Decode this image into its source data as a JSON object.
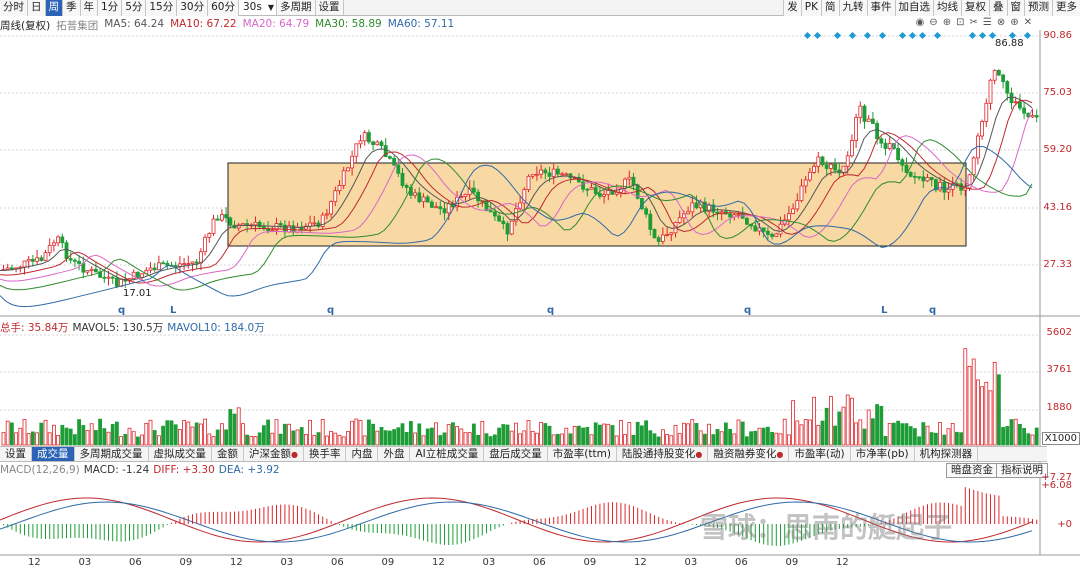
{
  "toolbar": {
    "periods": [
      "分时",
      "日",
      "周",
      "季",
      "年",
      "1分",
      "5分",
      "15分",
      "30分",
      "60分"
    ],
    "active_period": "周",
    "interval_select": "30s",
    "extra": [
      "多周期",
      "设置"
    ],
    "right_buttons": [
      "发",
      "PK",
      "简",
      "九转",
      "事件",
      "加自选",
      "均线",
      "复权",
      "叠",
      "窗",
      "预测",
      "更多"
    ]
  },
  "main_legend": {
    "title": "周线(复权)",
    "stock": "拓普集团",
    "ma5": "MA5: 64.24",
    "ma10": "MA10: 67.22",
    "ma20": "MA20: 64.79",
    "ma30": "MA30: 58.89",
    "ma60": "MA60: 57.11"
  },
  "price_axis": [
    "90.86",
    "75.03",
    "59.20",
    "43.16",
    "27.33"
  ],
  "annotations": {
    "high": "86.88",
    "low": "17.01"
  },
  "markers": [
    "q",
    "L",
    "q",
    "q",
    "q",
    "L",
    "q"
  ],
  "volume_legend": {
    "total": "总手: 35.84万",
    "mavol5": "MAVOL5: 130.5万",
    "mavol10": "MAVOL10: 184.0万"
  },
  "volume_axis": [
    "5602",
    "3761",
    "1880"
  ],
  "volume_scale": "X1000",
  "tabs": [
    "设置",
    "成交量",
    "多周期成交量",
    "虚拟成交量",
    "金额",
    "沪深金额",
    "换手率",
    "内盘",
    "外盘",
    "AI立桩成交量",
    "盘后成交量",
    "市盈率(ttm)",
    "陆股通持股变化",
    "融资融券变化",
    "市盈率(动)",
    "市净率(pb)",
    "机构探测器"
  ],
  "active_tab": "成交量",
  "macd_legend": {
    "name": "MACD(12,26,9)",
    "macd": "MACD: -1.24",
    "diff": "DIFF: +3.30",
    "dea": "DEA: +3.92"
  },
  "macd_axis": [
    "+7.27",
    "+6.08",
    "+0"
  ],
  "macd_buttons": [
    "暗盘资金",
    "指标说明"
  ],
  "x_labels": [
    "12",
    "03",
    "06",
    "09",
    "12",
    "03",
    "06",
    "09",
    "12",
    "03",
    "06",
    "09",
    "12",
    "03",
    "06",
    "09",
    "12"
  ],
  "watermark": "雪球：思南的艇起子",
  "colors": {
    "up": "#e0262b",
    "down": "#1e9c37",
    "box": "#f7d9a6"
  }
}
